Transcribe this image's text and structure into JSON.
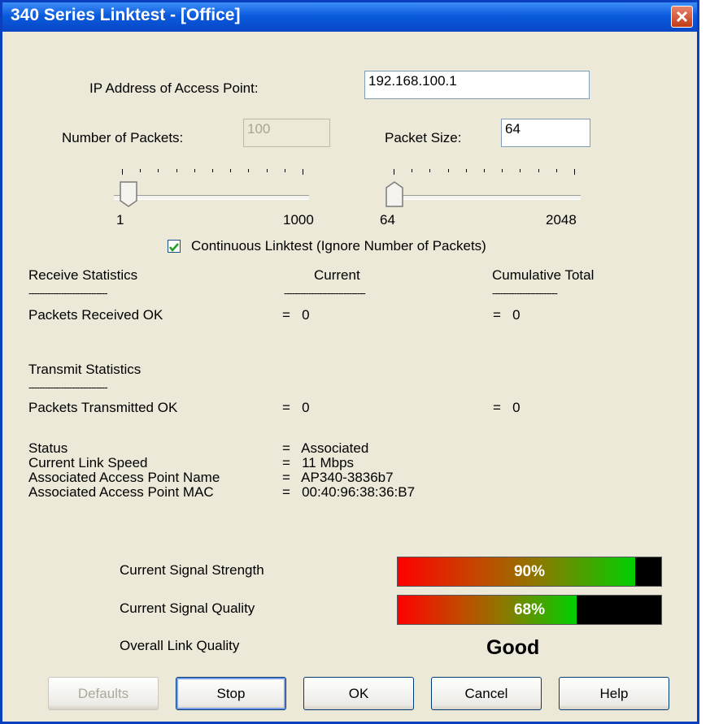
{
  "window": {
    "title": "340 Series Linktest - [Office]"
  },
  "ip": {
    "label": "IP Address of Access Point:",
    "value": "192.168.100.1"
  },
  "packets": {
    "label": "Number of Packets:",
    "value": "100",
    "min": "1",
    "max": "1000",
    "slider_fraction": 0.03
  },
  "packet_size": {
    "label": "Packet Size:",
    "value": "64",
    "min": "64",
    "max": "2048",
    "slider_fraction": 0.0
  },
  "continuous": {
    "label": "Continuous Linktest (Ignore Number of Packets)",
    "checked": true
  },
  "receive": {
    "header": "Receive Statistics",
    "current_header": "Current",
    "cumulative_header": "Cumulative Total",
    "dashes_a": "-----------------------------",
    "dashes_b": "------------------------------",
    "dashes_c": "------------------------",
    "row_label": "Packets Received OK",
    "current": "=   0",
    "cumulative": "=   0"
  },
  "transmit": {
    "header": "Transmit Statistics",
    "dashes": "-----------------------------",
    "row_label": "Packets Transmitted OK",
    "current": "=   0",
    "cumulative": "=   0"
  },
  "info": [
    {
      "label": "Status",
      "value": "=   Associated"
    },
    {
      "label": "Current Link Speed",
      "value": "=   11 Mbps"
    },
    {
      "label": "Associated Access Point Name",
      "value": "=   AP340-3836b7"
    },
    {
      "label": "Associated Access Point MAC",
      "value": "=   00:40:96:38:36:B7"
    }
  ],
  "signal_strength": {
    "label": "Current Signal Strength",
    "percent": 90,
    "text": "90%"
  },
  "signal_quality": {
    "label": "Current Signal Quality",
    "percent": 68,
    "text": "68%"
  },
  "link_quality": {
    "label": "Overall Link Quality",
    "value": "Good"
  },
  "buttons": {
    "defaults": "Defaults",
    "stop": "Stop",
    "ok": "OK",
    "cancel": "Cancel",
    "help": "Help"
  },
  "colors": {
    "titlebar": "#0a5bdd",
    "dialog": "#ece9d8"
  }
}
